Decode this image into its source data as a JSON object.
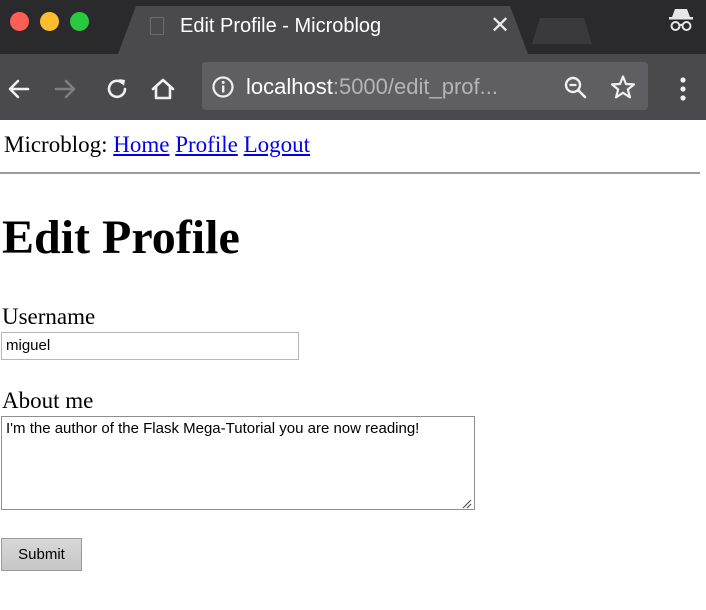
{
  "browser": {
    "tab_title": "Edit Profile - Microblog",
    "tab_close_glyph": "✕",
    "url_host": "localhost",
    "url_rest": ":5000/edit_prof...",
    "icons": [
      "back-icon",
      "forward-icon",
      "reload-icon",
      "home-icon",
      "info-icon",
      "zoom-icon",
      "star-icon",
      "menu-icon",
      "incognito-icon"
    ]
  },
  "nav": {
    "brand": "Microblog:",
    "links": [
      "Home",
      "Profile",
      "Logout"
    ]
  },
  "page": {
    "heading": "Edit Profile"
  },
  "form": {
    "username_label": "Username",
    "username_value": "miguel",
    "about_label": "About me",
    "about_value": "I'm the author of the Flask Mega-Tutorial you are now reading!",
    "submit_label": "Submit"
  }
}
